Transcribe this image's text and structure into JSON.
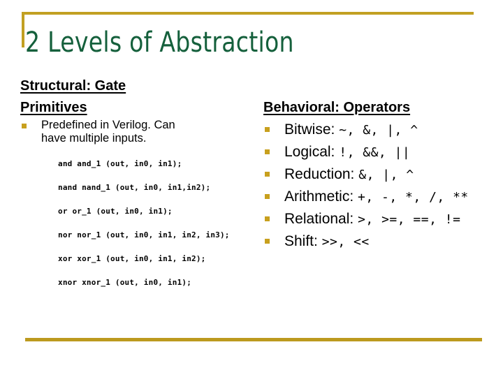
{
  "slide": {
    "title": "2 Levels of Abstraction",
    "accent_color": "#C2A022",
    "title_color": "#15603C",
    "bullet_color": "#C8A01E"
  },
  "left_column": {
    "heading_line1": "Structural: Gate",
    "heading_line2": "Primitives",
    "bullets": [
      {
        "text": "Predefined in Verilog. Can have multiple inputs."
      }
    ],
    "code_lines": [
      {
        "text": "and and_1 (out, in0, in1);"
      },
      {
        "text": "nand nand_1 (out, in0, in1,in2);"
      },
      {
        "text": "or or_1 (out, in0, in1);"
      },
      {
        "text": "nor nor_1 (out, in0, in1, in2, in3);"
      },
      {
        "text": "xor xor_1 (out, in0, in1, in2);"
      },
      {
        "text": "xnor xnor_1 (out, in0, in1);"
      }
    ]
  },
  "right_column": {
    "heading": "Behavioral: Operators",
    "bullets": [
      {
        "label": "Bitwise:",
        "operators": "~, &, |, ^"
      },
      {
        "label": "Logical:",
        "operators": "!, &&, ||"
      },
      {
        "label": "Reduction:",
        "operators": "&, |, ^"
      },
      {
        "label": "Arithmetic:",
        "operators": "+, -, *, /, **"
      },
      {
        "label": "Relational:",
        "operators": ">, >=, ==, !="
      },
      {
        "label": "Shift:",
        "operators": ">>, <<"
      }
    ]
  }
}
